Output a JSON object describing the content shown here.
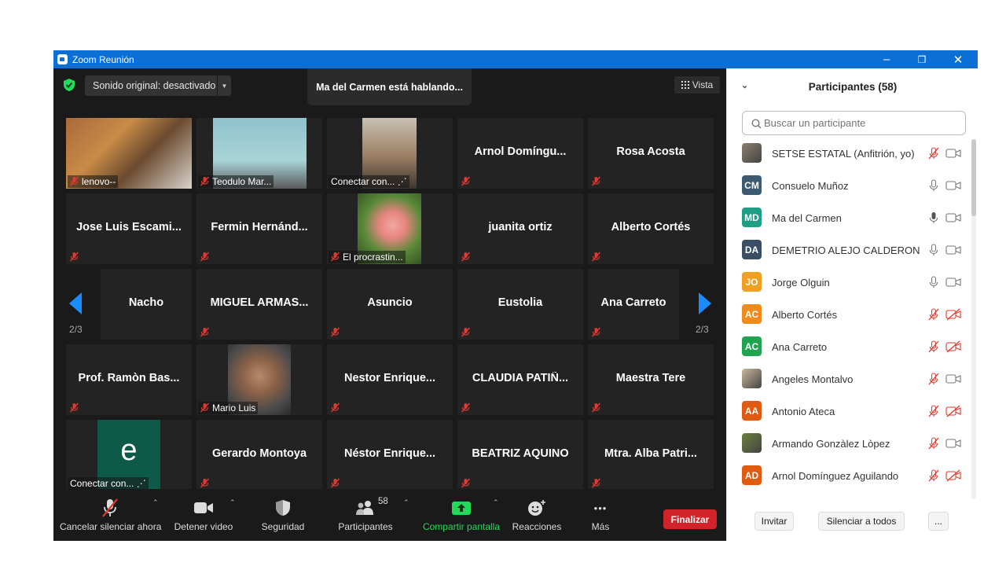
{
  "window": {
    "title": "Zoom Reunión",
    "minimize": "–",
    "restore": "❐",
    "close": "✕"
  },
  "top_bar": {
    "sound_label": "Sonido original: desactivado",
    "speaking": "Ma del Carmen está hablando...",
    "view_label": "Vista"
  },
  "colors": {
    "titlebar": "#0b6fd6",
    "muted_red": "#e0392f",
    "share_green": "#23d959",
    "end_red": "#d1242a",
    "shield_green": "#23d959"
  },
  "pager": {
    "left_page": "2/3",
    "right_page": "2/3"
  },
  "tiles": [
    {
      "name": "lenovo--",
      "video": true
    },
    {
      "name": "Teodulo Mar...",
      "video": true
    },
    {
      "name": "Conectar con... ⋰",
      "video": true
    },
    {
      "name": "Arnol  Domíngu...",
      "video": false
    },
    {
      "name": "Rosa Acosta",
      "video": false
    },
    {
      "name": "Jose Luis Escami...",
      "video": false
    },
    {
      "name": "Fermin  Hernánd...",
      "video": false
    },
    {
      "name": "El procrastin...",
      "video": true
    },
    {
      "name": "juanita ortiz",
      "video": false
    },
    {
      "name": "Alberto Cortés",
      "video": false
    },
    {
      "name": "Nacho",
      "video": false
    },
    {
      "name": "MIGUEL  ARMAS...",
      "video": false
    },
    {
      "name": "Asuncio",
      "video": false
    },
    {
      "name": "Eustolia",
      "video": false
    },
    {
      "name": "Ana Carreto",
      "video": false
    },
    {
      "name": "Prof. Ramòn Bas...",
      "video": false
    },
    {
      "name": "Mario Luis",
      "video": true
    },
    {
      "name": "Nestor  Enrique...",
      "video": false
    },
    {
      "name": "CLAUDIA  PATIÑ...",
      "video": false
    },
    {
      "name": "Maestra Tere",
      "video": false
    },
    {
      "name": "Conectar con... ⋰",
      "video": true,
      "letter": "e"
    },
    {
      "name": "Gerardo Montoya",
      "video": false
    },
    {
      "name": "Néstor  Enrique...",
      "video": false
    },
    {
      "name": "BEATRIZ AQUINO",
      "video": false
    },
    {
      "name": "Mtra. Alba Patri...",
      "video": false
    }
  ],
  "toolbar": {
    "mute": "Cancelar silenciar ahora",
    "video": "Detener video",
    "security": "Seguridad",
    "participants": "Participantes",
    "participants_count": "58",
    "share": "Compartir pantalla",
    "reactions": "Reacciones",
    "more": "Más",
    "more_dots": "•••",
    "end": "Finalizar"
  },
  "panel": {
    "title": "Participantes (58)",
    "search_placeholder": "Buscar un participante",
    "participants": [
      {
        "name": "SETSE ESTATAL (Anfitrión, yo)",
        "initials": "",
        "color": "#8a7f6d",
        "mic": "muted",
        "cam": "on"
      },
      {
        "name": "Consuelo Muñoz",
        "initials": "CM",
        "color": "#3d5a73",
        "mic": "on",
        "cam": "on"
      },
      {
        "name": "Ma del Carmen",
        "initials": "MD",
        "color": "#1e9e84",
        "mic": "talking",
        "cam": "on"
      },
      {
        "name": "DEMETRIO ALEJO CALDERON",
        "initials": "DA",
        "color": "#3a4f63",
        "mic": "on",
        "cam": "on"
      },
      {
        "name": "Jorge Olguin",
        "initials": "JO",
        "color": "#f0a020",
        "mic": "on",
        "cam": "on"
      },
      {
        "name": "Alberto Cortés",
        "initials": "AC",
        "color": "#ef8b1c",
        "mic": "muted",
        "cam": "off"
      },
      {
        "name": "Ana Carreto",
        "initials": "AC",
        "color": "#22a352",
        "mic": "muted",
        "cam": "off"
      },
      {
        "name": "Angeles Montalvo",
        "initials": "",
        "color": "#c9b89a",
        "mic": "muted",
        "cam": "on"
      },
      {
        "name": "Antonio Ateca",
        "initials": "AA",
        "color": "#e05a12",
        "mic": "muted",
        "cam": "off"
      },
      {
        "name": "Armando Gonzàlez Lòpez",
        "initials": "",
        "color": "#6b7f3a",
        "mic": "muted",
        "cam": "on"
      },
      {
        "name": "Arnol Domínguez Aguilando",
        "initials": "AD",
        "color": "#e05a12",
        "mic": "muted",
        "cam": "off"
      }
    ],
    "invite": "Invitar",
    "mute_all": "Silenciar a todos",
    "more": "..."
  }
}
